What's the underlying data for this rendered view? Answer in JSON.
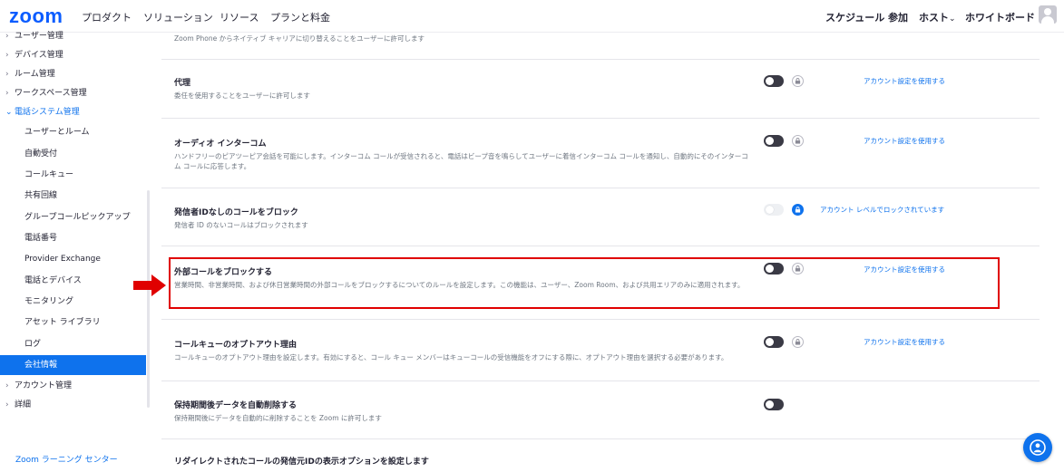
{
  "nav": {
    "logo": "zoom",
    "left": [
      "プロダクト",
      "ソリューション",
      "リソース",
      "プランと料金"
    ],
    "right": [
      "スケジュール",
      "参加",
      "ホスト",
      "ホワイトボード"
    ],
    "host_chevron": "⌄"
  },
  "sidebar": {
    "items": [
      {
        "label": "ユーザー管理",
        "chev": "›"
      },
      {
        "label": "デバイス管理",
        "chev": "›"
      },
      {
        "label": "ルーム管理",
        "chev": "›"
      },
      {
        "label": "ワークスペース管理",
        "chev": "›"
      },
      {
        "label": "電話システム管理",
        "chev": "⌄"
      },
      {
        "label": "ユーザーとルーム"
      },
      {
        "label": "自動受付"
      },
      {
        "label": "コールキュー"
      },
      {
        "label": "共有回線"
      },
      {
        "label": "グループコールピックアップ"
      },
      {
        "label": "電話番号"
      },
      {
        "label": "Provider Exchange"
      },
      {
        "label": "電話とデバイス"
      },
      {
        "label": "モニタリング"
      },
      {
        "label": "アセット ライブラリ"
      },
      {
        "label": "ログ"
      },
      {
        "label": "会社情報"
      },
      {
        "label": "アカウント管理",
        "chev": "›"
      },
      {
        "label": "詳細",
        "chev": "›"
      }
    ],
    "footer": "Zoom ラーニング センター"
  },
  "settings": {
    "top_desc": "Zoom Phone からネイティブ キャリアに切り替えることをユーザーに許可します",
    "rows": [
      {
        "title": "代理",
        "desc": "委任を使用することをユーザーに許可します",
        "link": "アカウント設定を使用する"
      },
      {
        "title": "オーディオ インターコム",
        "desc": "ハンドフリーのピアツーピア会話を可能にします。インターコム コールが受信されると、電話はビープ音を鳴らしてユーザーに着信インターコム コールを通知し、自動的にそのインターコム コールに応答します。",
        "link": "アカウント設定を使用する"
      },
      {
        "title": "発信者IDなしのコールをブロック",
        "desc": "発信者 ID のないコールはブロックされます",
        "link": "アカウント レベルでロックされています"
      },
      {
        "title": "外部コールをブロックする",
        "desc": "営業時間、非営業時間、および休日営業時間の外部コールをブロックするについてのルールを設定します。この機能は、ユーザー、Zoom Room、および共用エリアのみに適用されます。",
        "link": "アカウント設定を使用する"
      },
      {
        "title": "コールキューのオプトアウト理由",
        "desc": "コールキューのオプトアウト理由を設定します。有効にすると、コール キュー メンバーはキューコールの受信機能をオフにする際に、オプトアウト理由を選択する必要があります。",
        "link": "アカウント設定を使用する"
      },
      {
        "title": "保持期間後データを自動削除する",
        "desc": "保持期間後にデータを自動的に削除することを Zoom に許可します"
      },
      {
        "title": "リダイレクトされたコールの発信元IDの表示オプションを設定します"
      }
    ]
  },
  "colors": {
    "accent": "#0e72ed",
    "highlight": "#e00000",
    "toggle_off": "#3a3a45"
  },
  "icons": [
    "lock-icon",
    "arrow-right-icon",
    "help-icon",
    "user-avatar-icon"
  ]
}
